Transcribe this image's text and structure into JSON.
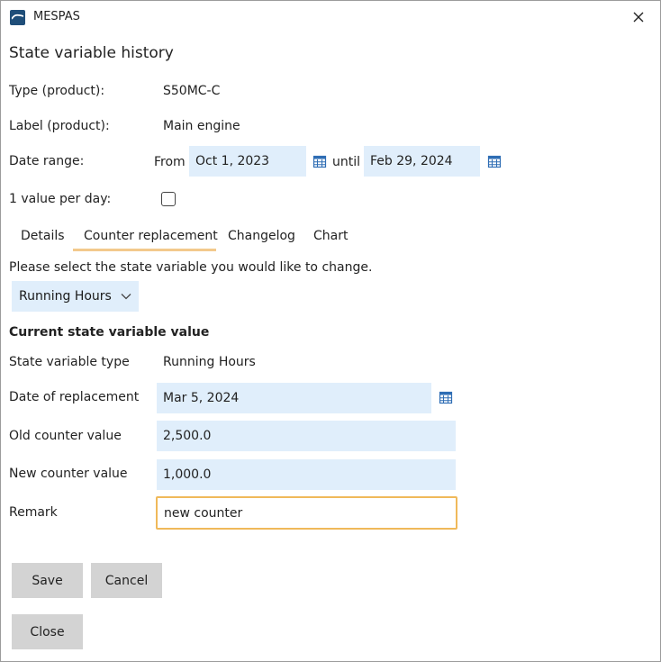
{
  "window": {
    "app_title": "MESPAS",
    "dialog_title": "State variable history"
  },
  "info": {
    "type_label": "Type (product):",
    "type_value": "S50MC-C",
    "label_label": "Label (product):",
    "label_value": "Main engine",
    "date_range_label": "Date range:",
    "from_label": "From",
    "from_value": "Oct 1, 2023",
    "until_label": "until",
    "until_value": "Feb 29, 2024",
    "per_day_label": "1 value per day:",
    "per_day_checked": false
  },
  "tabs": [
    {
      "label": "Details",
      "active": false
    },
    {
      "label": "Counter replacement",
      "active": true
    },
    {
      "label": "Changelog",
      "active": false
    },
    {
      "label": "Chart",
      "active": false
    }
  ],
  "counter": {
    "instruction": "Please select the state variable you would like to change.",
    "selected_variable": "Running Hours",
    "section_title": "Current state variable value",
    "sv_type_label": "State variable type",
    "sv_type_value": "Running Hours",
    "date_label": "Date of replacement",
    "date_value": "Mar 5, 2024",
    "old_label": "Old counter value",
    "old_value": "2,500.0",
    "new_label": "New counter value",
    "new_value": "1,000.0",
    "remark_label": "Remark",
    "remark_value": "new counter"
  },
  "buttons": {
    "save": "Save",
    "cancel": "Cancel",
    "close": "Close"
  },
  "icons": {
    "app": "app-logo-icon",
    "close": "close-icon",
    "calendar": "calendar-icon",
    "dropdown": "chevron-down-icon"
  },
  "colors": {
    "field_bg": "#e0eefb",
    "accent": "#f3c98c",
    "focus_border": "#f0b95a",
    "button_bg": "#d3d3d3",
    "icon_blue": "#2e6db4"
  }
}
